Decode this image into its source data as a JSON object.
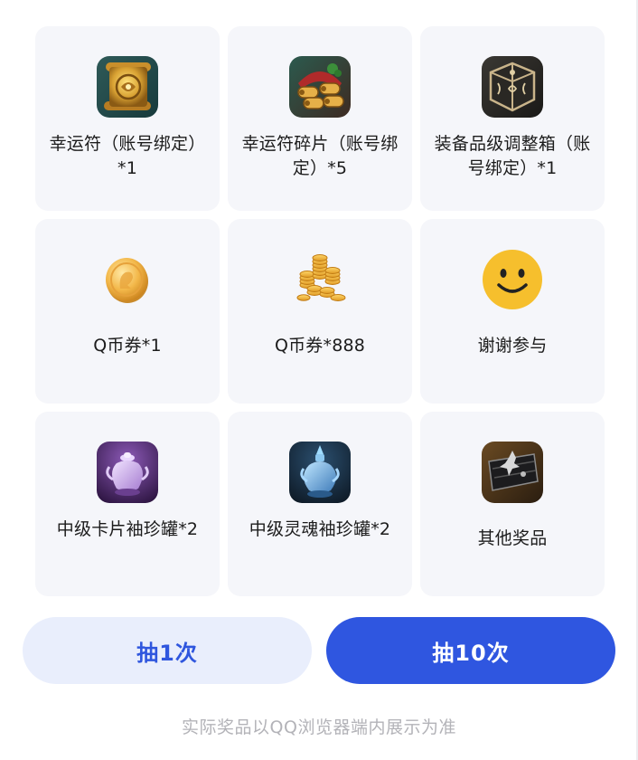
{
  "prizes": [
    {
      "label": "幸运符（账号绑定）*1",
      "icon": "lucky-charm-scroll-icon"
    },
    {
      "label": "幸运符碎片（账号绑定）*5",
      "icon": "lucky-charm-fragment-scrolls-icon"
    },
    {
      "label": "装备品级调整箱（账号绑定）*1",
      "icon": "equipment-grade-box-icon"
    },
    {
      "label": "Q币券*1",
      "icon": "gold-coin-icon"
    },
    {
      "label": "Q币券*888",
      "icon": "gold-coin-stack-icon"
    },
    {
      "label": "谢谢参与",
      "icon": "smiley-face-icon"
    },
    {
      "label": "中级卡片袖珍罐*2",
      "icon": "purple-card-jar-icon"
    },
    {
      "label": "中级灵魂袖珍罐*2",
      "icon": "blue-soul-jar-icon"
    },
    {
      "label": "其他奖品",
      "icon": "other-prize-chest-icon"
    }
  ],
  "actions": {
    "draw_once": "抽1次",
    "draw_ten": "抽10次"
  },
  "footnote": "实际奖品以QQ浏览器端内展示为准",
  "colors": {
    "primary": "#2f56e0",
    "primary_light": "#e9eefc",
    "card_bg": "#f5f6fa",
    "footnote": "#b3b3b8"
  }
}
